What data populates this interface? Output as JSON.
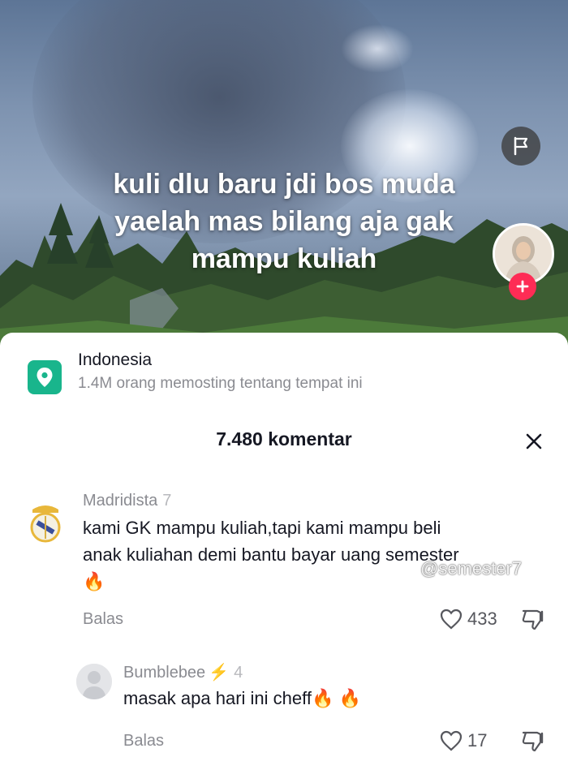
{
  "video": {
    "caption_lines": [
      "kuli dlu baru jdi bos muda",
      "yaelah mas bilang aja gak",
      "mampu kuliah"
    ]
  },
  "location": {
    "name": "Indonesia",
    "subtitle": "1.4M orang memosting tentang tempat ini"
  },
  "comments_header": {
    "title": "7.480 komentar"
  },
  "comments": [
    {
      "username": "Madridista",
      "age": "7",
      "text_line1": "kami GK mampu kuliah,tapi kami mampu beli",
      "text_line2": "anak kuliahan demi bantu bayar uang semester",
      "emoji": "🔥",
      "reply_label": "Balas",
      "likes": "433"
    },
    {
      "username": "Bumblebee",
      "age": "4",
      "text": "masak apa hari ini cheff",
      "emoji": "🔥 🔥",
      "reply_label": "Balas",
      "likes": "17"
    }
  ],
  "watermark": "@semester7",
  "icons": {
    "flag": "flag-icon",
    "follow": "plus-icon",
    "location": "location-pin-icon",
    "close": "close-icon",
    "like": "heart-outline-icon",
    "dislike": "thumbs-down-icon"
  },
  "colors": {
    "accent": "#fe2c55",
    "location_icon": "#19b58c",
    "text_primary": "#161823",
    "text_secondary": "#8a8b91"
  }
}
